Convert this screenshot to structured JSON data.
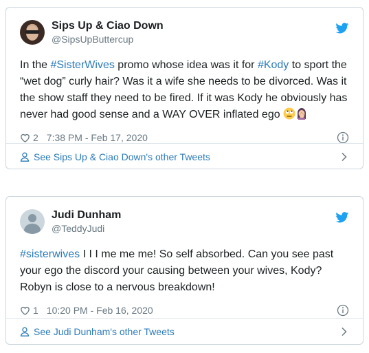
{
  "tweets": [
    {
      "display_name": "Sips Up & Ciao Down",
      "handle": "@SipsUpButtercup",
      "text_parts": [
        "In the ",
        "#SisterWives",
        " promo whose idea was it for ",
        "#Kody",
        " to sport the “wet dog” curly hair? Was it a wife she needs to be divorced. Was it the show staff they need to be fired. If it was Kody he obviously has never had good sense and a WAY OVER inflated ego "
      ],
      "emojis": [
        "face-with-rolling-eyes-emoji",
        "woman-facepalming-emoji"
      ],
      "likes": "2",
      "timestamp": "7:38 PM - Feb 17, 2020",
      "other_tweets_label": "See Sips Up & Ciao Down's other Tweets"
    },
    {
      "display_name": "Judi Dunham",
      "handle": "@TeddyJudi",
      "text_parts": [
        "#sisterwives",
        " I I I me me me!  So self absorbed.  Can you see past your ego the discord your causing between your wives, Kody? Robyn is close to a nervous breakdown!"
      ],
      "likes": "1",
      "timestamp": "10:20 PM - Feb 16, 2020",
      "other_tweets_label": "See Judi Dunham's other Tweets"
    }
  ],
  "colors": {
    "link": "#2b7bb9",
    "twitter_blue": "#1da1f2",
    "muted": "#697882",
    "border": "#ccd6dd"
  }
}
